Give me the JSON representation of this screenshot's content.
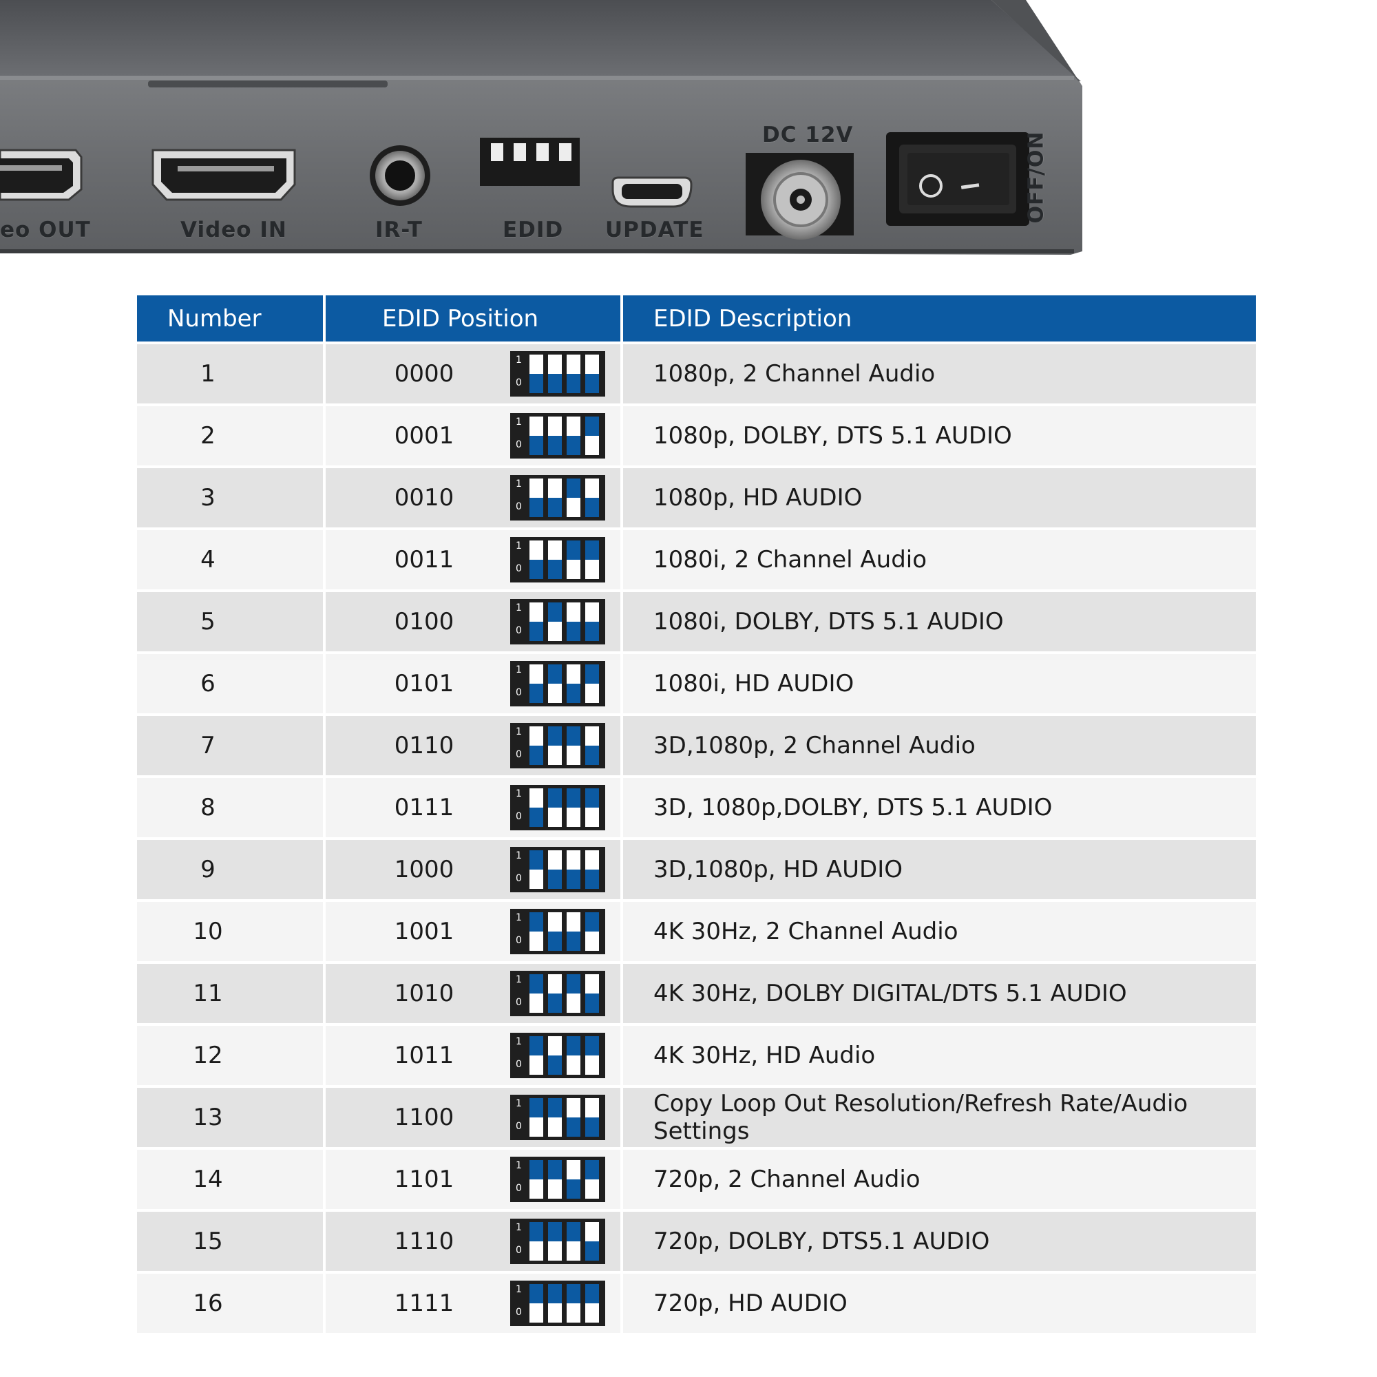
{
  "device": {
    "labels": {
      "video_out": "eo OUT",
      "video_in": "Video IN",
      "ir": "IR-T",
      "edid": "EDID",
      "update": "UPDATE",
      "dc": "DC 12V",
      "power": "OFF/ON"
    }
  },
  "table": {
    "headers": {
      "number": "Number",
      "position": "EDID Position",
      "description": "EDID Description"
    },
    "rows": [
      {
        "number": "1",
        "position": "0000",
        "description": "1080p, 2 Channel Audio"
      },
      {
        "number": "2",
        "position": "0001",
        "description": "1080p, DOLBY, DTS 5.1 AUDIO"
      },
      {
        "number": "3",
        "position": "0010",
        "description": "1080p, HD AUDIO"
      },
      {
        "number": "4",
        "position": "0011",
        "description": "1080i, 2 Channel Audio"
      },
      {
        "number": "5",
        "position": "0100",
        "description": "1080i, DOLBY, DTS 5.1 AUDIO"
      },
      {
        "number": "6",
        "position": "0101",
        "description": "1080i, HD AUDIO"
      },
      {
        "number": "7",
        "position": "0110",
        "description": "3D,1080p, 2 Channel Audio"
      },
      {
        "number": "8",
        "position": "0111",
        "description": "3D, 1080p,DOLBY, DTS 5.1 AUDIO"
      },
      {
        "number": "9",
        "position": "1000",
        "description": "3D,1080p, HD AUDIO"
      },
      {
        "number": "10",
        "position": "1001",
        "description": "4K 30Hz, 2 Channel Audio"
      },
      {
        "number": "11",
        "position": "1010",
        "description": "4K 30Hz, DOLBY DIGITAL/DTS 5.1 AUDIO"
      },
      {
        "number": "12",
        "position": "1011",
        "description": "4K 30Hz, HD Audio"
      },
      {
        "number": "13",
        "position": "1100",
        "description": "Copy Loop Out Resolution/Refresh Rate/Audio Settings"
      },
      {
        "number": "14",
        "position": "1101",
        "description": "720p, 2 Channel Audio"
      },
      {
        "number": "15",
        "position": "1110",
        "description": "720p, DOLBY, DTS5.1 AUDIO"
      },
      {
        "number": "16",
        "position": "1111",
        "description": "720p, HD AUDIO"
      }
    ],
    "dip_labels": {
      "one": "1",
      "zero": "0"
    }
  },
  "colors": {
    "accent": "#0c5aa2",
    "row_odd": "#e3e3e3",
    "row_even": "#f4f4f4",
    "device_body": "#6b6d70"
  },
  "icons": [
    "hdmi-port-icon",
    "audio-jack-icon",
    "dip-switch-icon",
    "micro-usb-icon",
    "dc-jack-icon",
    "rocker-switch-icon"
  ]
}
